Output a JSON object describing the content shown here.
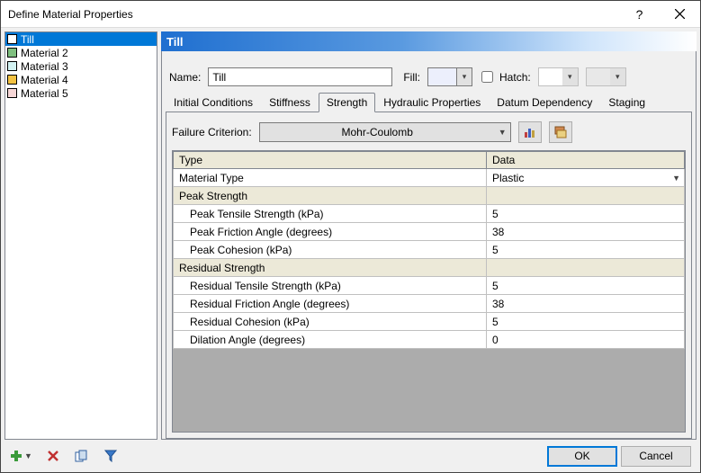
{
  "window": {
    "title": "Define Material Properties"
  },
  "materials": [
    {
      "name": "Till",
      "color": "#ffffff",
      "selected": true
    },
    {
      "name": "Material 2",
      "color": "#7fbf7f",
      "selected": false
    },
    {
      "name": "Material 3",
      "color": "#d3f3f3",
      "selected": false
    },
    {
      "name": "Material 4",
      "color": "#f3c242",
      "selected": false
    },
    {
      "name": "Material 5",
      "color": "#f7d7d7",
      "selected": false
    }
  ],
  "header": {
    "current_material": "Till"
  },
  "form": {
    "name_label": "Name:",
    "name_value": "Till",
    "fill_label": "Fill:",
    "fill_value": "",
    "hatch_label": "Hatch:",
    "hatch_checked": false
  },
  "tabs": {
    "items": [
      "Initial Conditions",
      "Stiffness",
      "Strength",
      "Hydraulic Properties",
      "Datum Dependency",
      "Staging"
    ],
    "active_index": 2
  },
  "strength": {
    "criterion_label": "Failure Criterion:",
    "criterion_value": "Mohr-Coulomb",
    "columns": {
      "type": "Type",
      "data": "Data"
    },
    "rows": [
      {
        "label": "Material Type",
        "value": "Plastic",
        "kind": "dropdown"
      },
      {
        "label": "Peak Strength",
        "kind": "group"
      },
      {
        "label": "Peak Tensile Strength (kPa)",
        "value": "5",
        "kind": "indent"
      },
      {
        "label": "Peak Friction Angle (degrees)",
        "value": "38",
        "kind": "indent"
      },
      {
        "label": "Peak Cohesion (kPa)",
        "value": "5",
        "kind": "indent"
      },
      {
        "label": "Residual Strength",
        "kind": "group"
      },
      {
        "label": "Residual Tensile Strength (kPa)",
        "value": "5",
        "kind": "indent"
      },
      {
        "label": "Residual Friction Angle (degrees)",
        "value": "38",
        "kind": "indent"
      },
      {
        "label": "Residual Cohesion (kPa)",
        "value": "5",
        "kind": "indent"
      },
      {
        "label": "Dilation Angle (degrees)",
        "value": "0",
        "kind": "indent"
      }
    ]
  },
  "buttons": {
    "ok": "OK",
    "cancel": "Cancel"
  }
}
